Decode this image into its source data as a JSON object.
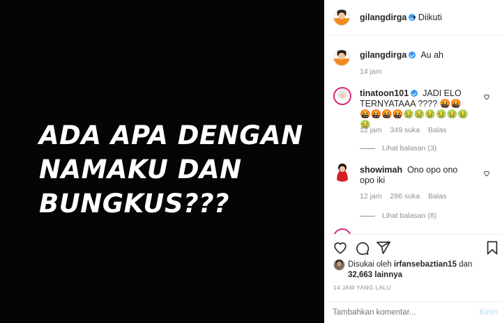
{
  "post": {
    "text_lines": [
      "ADA APA DENGAN",
      "NAMAKU DAN",
      "BUNGKUS???"
    ]
  },
  "header": {
    "username": "gilangdirga",
    "follow_status": "• Diikuti"
  },
  "caption": {
    "username": "gilangdirga",
    "text": "Au ah",
    "time": "14 jam"
  },
  "comments": [
    {
      "username": "tinatoon101",
      "text": "JADI ELO TERNYATAAA ???? 🤬🤬🤬🤬🤬🤬🤢🤢🤢🤢🤢🤢🤢",
      "time": "12 jam",
      "likes": "349 suka",
      "reply": "Balas",
      "view_replies": "Lihat balasan (3)"
    },
    {
      "username": "showimah",
      "text": "Ono opo ono opo iki",
      "time": "12 jam",
      "likes": "286 suka",
      "reply": "Balas",
      "view_replies": "Lihat balasan (8)"
    }
  ],
  "likes": {
    "prefix": "Disukai oleh",
    "user": "irfansebaztian15",
    "connector": "dan",
    "count": "32,663",
    "suffix": "lainnya"
  },
  "time_ago": "14 JAM YANG LALU",
  "add_comment": {
    "placeholder": "Tambahkan komentar...",
    "post_label": "Kirim"
  },
  "icons": {
    "like": "heart-icon",
    "comment": "comment-icon",
    "share": "share-icon",
    "save": "bookmark-icon"
  }
}
